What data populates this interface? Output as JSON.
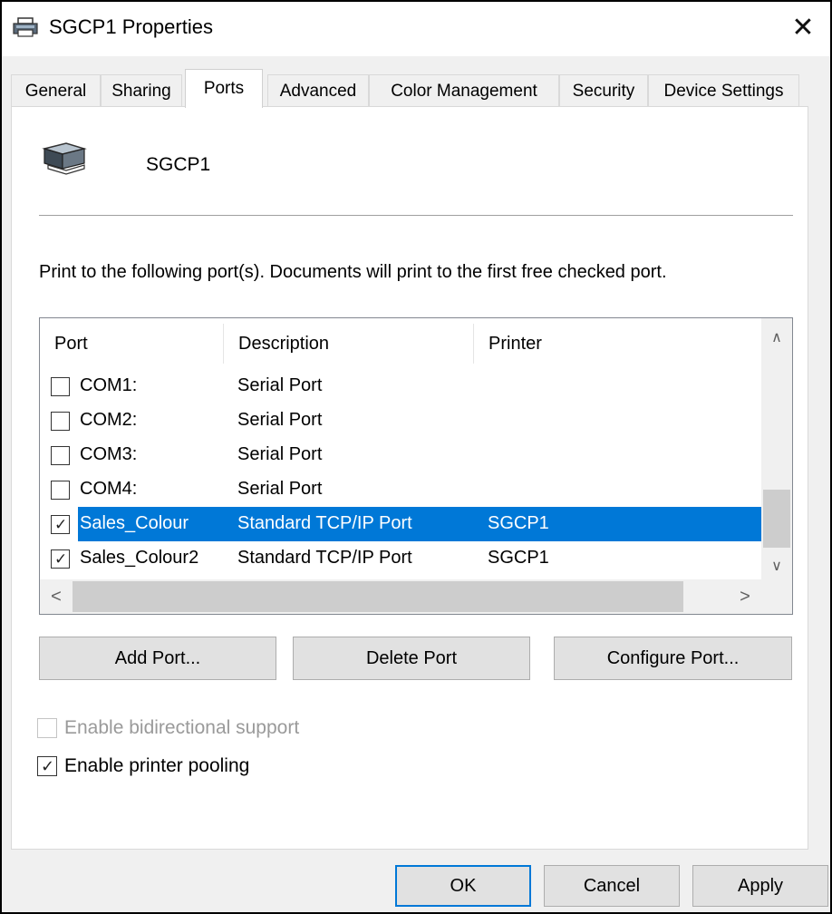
{
  "window": {
    "title": "SGCP1 Properties",
    "close_glyph": "✕",
    "icons": {
      "title": "printer-icon",
      "close": "close-icon"
    }
  },
  "tabs": [
    {
      "label": "General",
      "active": false
    },
    {
      "label": "Sharing",
      "active": false
    },
    {
      "label": "Ports",
      "active": true
    },
    {
      "label": "Advanced",
      "active": false
    },
    {
      "label": "Color Management",
      "active": false
    },
    {
      "label": "Security",
      "active": false
    },
    {
      "label": "Device Settings",
      "active": false
    }
  ],
  "printer": {
    "name": "SGCP1",
    "icon": "printer-icon"
  },
  "description": "Print to the following port(s). Documents will print to the first free checked port.",
  "port_list": {
    "columns": [
      "Port",
      "Description",
      "Printer"
    ],
    "rows": [
      {
        "port": "COM1:",
        "description": "Serial Port",
        "printer": "",
        "checked": false,
        "selected": false
      },
      {
        "port": "COM2:",
        "description": "Serial Port",
        "printer": "",
        "checked": false,
        "selected": false
      },
      {
        "port": "COM3:",
        "description": "Serial Port",
        "printer": "",
        "checked": false,
        "selected": false
      },
      {
        "port": "COM4:",
        "description": "Serial Port",
        "printer": "",
        "checked": false,
        "selected": false
      },
      {
        "port": "Sales_Colour",
        "description": "Standard TCP/IP Port",
        "printer": "SGCP1",
        "checked": true,
        "selected": true
      },
      {
        "port": "Sales_Colour2",
        "description": "Standard TCP/IP Port",
        "printer": "SGCP1",
        "checked": true,
        "selected": false
      }
    ],
    "check_glyph": "✓",
    "scroll_up": "∧",
    "scroll_down": "∨",
    "scroll_left": "<",
    "scroll_right": ">",
    "selected_color": "#0078d7"
  },
  "buttons": {
    "add_port": "Add Port...",
    "delete_port": "Delete Port",
    "configure_port": "Configure Port..."
  },
  "options": {
    "bidirectional": {
      "label": "Enable bidirectional support",
      "checked": false,
      "enabled": false
    },
    "pooling": {
      "label": "Enable printer pooling",
      "checked": true,
      "enabled": true
    }
  },
  "footer": {
    "ok": "OK",
    "cancel": "Cancel",
    "apply": "Apply"
  }
}
